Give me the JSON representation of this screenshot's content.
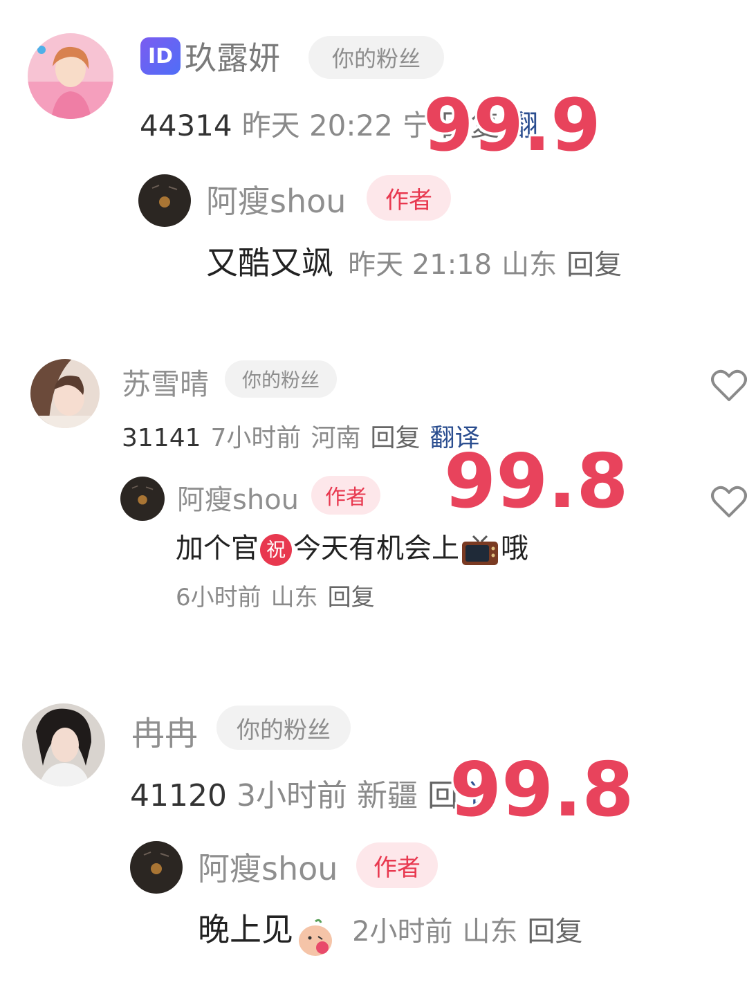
{
  "colors": {
    "accent_red": "#e8435c",
    "author_badge_bg": "#fde7ea",
    "fan_badge_bg": "#f2f2f2",
    "translate_blue": "#2a4d8f"
  },
  "comments": [
    {
      "username": "玖露妍",
      "has_id_badge": true,
      "id_badge_text": "ID",
      "fan_badge": "你的粉丝",
      "like_count": "44314",
      "time": "昨天 20:22",
      "location": "宁",
      "reply_label": "回复",
      "translate_label": "翻",
      "overlay_value": "99.9",
      "reply": {
        "username": "阿瘦shou",
        "author_badge": "作者",
        "content": "又酷又飒",
        "time": "昨天 21:18",
        "location": "山东",
        "reply_label": "回复"
      }
    },
    {
      "username": "苏雪晴",
      "fan_badge": "你的粉丝",
      "like_count": "31141",
      "time": "7小时前",
      "location": "河南",
      "reply_label": "回复",
      "translate_label": "翻译",
      "overlay_value": "99.8",
      "reply": {
        "username": "阿瘦shou",
        "author_badge": "作者",
        "content_part1": "加个官",
        "emoji_1": "祝",
        "content_part2": "今天有机会上",
        "content_part3": "哦",
        "time": "6小时前",
        "location": "山东",
        "reply_label": "回复"
      }
    },
    {
      "username": "冉冉",
      "fan_badge": "你的粉丝",
      "like_count": "41120",
      "time": "3小时前",
      "location": "新疆",
      "reply_label": "回",
      "translate_label": "译",
      "overlay_value": "99.8",
      "reply": {
        "username": "阿瘦shou",
        "author_badge": "作者",
        "content": "晚上见",
        "time": "2小时前",
        "location": "山东",
        "reply_label": "回复"
      }
    }
  ],
  "icons": {
    "like": "heart-icon",
    "tv": "tv-icon",
    "kiss": "kiss-emoji-icon",
    "blessing": "blessing-emoji-icon"
  }
}
